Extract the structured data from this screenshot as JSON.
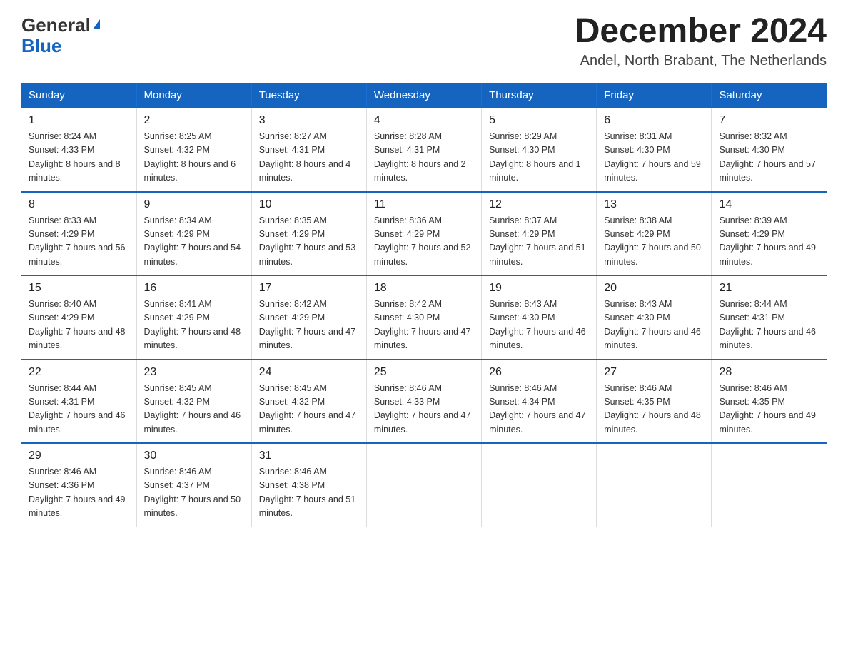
{
  "logo": {
    "line1": "General",
    "line2": "Blue"
  },
  "title": "December 2024",
  "subtitle": "Andel, North Brabant, The Netherlands",
  "weekdays": [
    "Sunday",
    "Monday",
    "Tuesday",
    "Wednesday",
    "Thursday",
    "Friday",
    "Saturday"
  ],
  "weeks": [
    [
      {
        "day": "1",
        "sunrise": "8:24 AM",
        "sunset": "4:33 PM",
        "daylight": "8 hours and 8 minutes."
      },
      {
        "day": "2",
        "sunrise": "8:25 AM",
        "sunset": "4:32 PM",
        "daylight": "8 hours and 6 minutes."
      },
      {
        "day": "3",
        "sunrise": "8:27 AM",
        "sunset": "4:31 PM",
        "daylight": "8 hours and 4 minutes."
      },
      {
        "day": "4",
        "sunrise": "8:28 AM",
        "sunset": "4:31 PM",
        "daylight": "8 hours and 2 minutes."
      },
      {
        "day": "5",
        "sunrise": "8:29 AM",
        "sunset": "4:30 PM",
        "daylight": "8 hours and 1 minute."
      },
      {
        "day": "6",
        "sunrise": "8:31 AM",
        "sunset": "4:30 PM",
        "daylight": "7 hours and 59 minutes."
      },
      {
        "day": "7",
        "sunrise": "8:32 AM",
        "sunset": "4:30 PM",
        "daylight": "7 hours and 57 minutes."
      }
    ],
    [
      {
        "day": "8",
        "sunrise": "8:33 AM",
        "sunset": "4:29 PM",
        "daylight": "7 hours and 56 minutes."
      },
      {
        "day": "9",
        "sunrise": "8:34 AM",
        "sunset": "4:29 PM",
        "daylight": "7 hours and 54 minutes."
      },
      {
        "day": "10",
        "sunrise": "8:35 AM",
        "sunset": "4:29 PM",
        "daylight": "7 hours and 53 minutes."
      },
      {
        "day": "11",
        "sunrise": "8:36 AM",
        "sunset": "4:29 PM",
        "daylight": "7 hours and 52 minutes."
      },
      {
        "day": "12",
        "sunrise": "8:37 AM",
        "sunset": "4:29 PM",
        "daylight": "7 hours and 51 minutes."
      },
      {
        "day": "13",
        "sunrise": "8:38 AM",
        "sunset": "4:29 PM",
        "daylight": "7 hours and 50 minutes."
      },
      {
        "day": "14",
        "sunrise": "8:39 AM",
        "sunset": "4:29 PM",
        "daylight": "7 hours and 49 minutes."
      }
    ],
    [
      {
        "day": "15",
        "sunrise": "8:40 AM",
        "sunset": "4:29 PM",
        "daylight": "7 hours and 48 minutes."
      },
      {
        "day": "16",
        "sunrise": "8:41 AM",
        "sunset": "4:29 PM",
        "daylight": "7 hours and 48 minutes."
      },
      {
        "day": "17",
        "sunrise": "8:42 AM",
        "sunset": "4:29 PM",
        "daylight": "7 hours and 47 minutes."
      },
      {
        "day": "18",
        "sunrise": "8:42 AM",
        "sunset": "4:30 PM",
        "daylight": "7 hours and 47 minutes."
      },
      {
        "day": "19",
        "sunrise": "8:43 AM",
        "sunset": "4:30 PM",
        "daylight": "7 hours and 46 minutes."
      },
      {
        "day": "20",
        "sunrise": "8:43 AM",
        "sunset": "4:30 PM",
        "daylight": "7 hours and 46 minutes."
      },
      {
        "day": "21",
        "sunrise": "8:44 AM",
        "sunset": "4:31 PM",
        "daylight": "7 hours and 46 minutes."
      }
    ],
    [
      {
        "day": "22",
        "sunrise": "8:44 AM",
        "sunset": "4:31 PM",
        "daylight": "7 hours and 46 minutes."
      },
      {
        "day": "23",
        "sunrise": "8:45 AM",
        "sunset": "4:32 PM",
        "daylight": "7 hours and 46 minutes."
      },
      {
        "day": "24",
        "sunrise": "8:45 AM",
        "sunset": "4:32 PM",
        "daylight": "7 hours and 47 minutes."
      },
      {
        "day": "25",
        "sunrise": "8:46 AM",
        "sunset": "4:33 PM",
        "daylight": "7 hours and 47 minutes."
      },
      {
        "day": "26",
        "sunrise": "8:46 AM",
        "sunset": "4:34 PM",
        "daylight": "7 hours and 47 minutes."
      },
      {
        "day": "27",
        "sunrise": "8:46 AM",
        "sunset": "4:35 PM",
        "daylight": "7 hours and 48 minutes."
      },
      {
        "day": "28",
        "sunrise": "8:46 AM",
        "sunset": "4:35 PM",
        "daylight": "7 hours and 49 minutes."
      }
    ],
    [
      {
        "day": "29",
        "sunrise": "8:46 AM",
        "sunset": "4:36 PM",
        "daylight": "7 hours and 49 minutes."
      },
      {
        "day": "30",
        "sunrise": "8:46 AM",
        "sunset": "4:37 PM",
        "daylight": "7 hours and 50 minutes."
      },
      {
        "day": "31",
        "sunrise": "8:46 AM",
        "sunset": "4:38 PM",
        "daylight": "7 hours and 51 minutes."
      },
      null,
      null,
      null,
      null
    ]
  ]
}
